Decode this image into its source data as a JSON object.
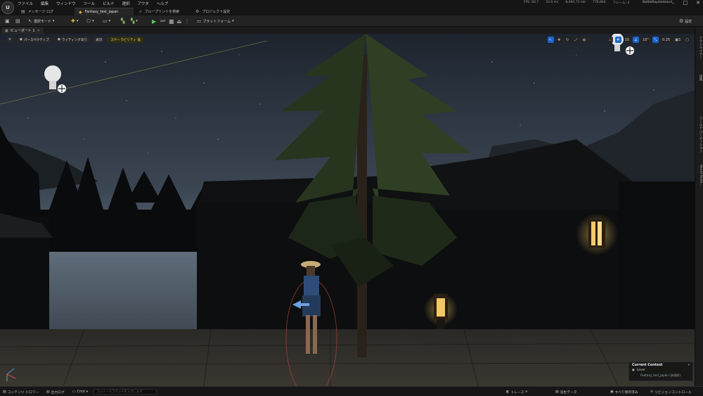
{
  "app": {
    "logo": "U",
    "menu": [
      "ファイル",
      "編集",
      "ウィンドウ",
      "ツール",
      "ビルド",
      "選択",
      "アクタ",
      "ヘルプ"
    ],
    "stats": [
      "FPS: 60.7",
      "33.9 ms",
      "8,494.73 mb",
      "778,864",
      "フレーム: 4"
    ],
    "project_name": "BattleRoyaleIsland",
    "window_controls": [
      "–",
      "□",
      "✕"
    ]
  },
  "tabs": [
    {
      "label": "メッセージ ログ"
    },
    {
      "label": "Fantasy_test_japan"
    },
    {
      "label": "ブループリントを検索"
    },
    {
      "label": "プロジェクト設定"
    }
  ],
  "toolbar": {
    "select_mode": "選択モード",
    "platform": "プラットフォーム",
    "settings": "設定"
  },
  "viewport_tab": {
    "label": "ビューポート 1"
  },
  "viewport_bar": {
    "perspective": "パースペクティブ",
    "lighting": "ライティングあり",
    "show": "表示",
    "scalability": "スケーラビリティ 低",
    "grid_value": "10",
    "angle_value": "10°",
    "scale_value": "0.25",
    "camera_speed": "3"
  },
  "side_dock": [
    "アウトライナー",
    "詳細",
    "ワールド パーティション",
    "World Partit..."
  ],
  "context": {
    "title": "Current Context",
    "level": "Level",
    "map": "Fantasy_test_japan (永続的)"
  },
  "status_bar": {
    "content_drawer": "コンテンツ ドロワー",
    "output_log": "出力ログ",
    "cmd": "Cmd",
    "cmd_placeholder": "コンソールコマンドを入力します",
    "trace": "トレース",
    "derived_data": "派生データ",
    "save_all": "すべて保存済み",
    "revision": "リビジョンコントロール"
  },
  "colors": {
    "sky_top": "#1d242e",
    "sky_horizon": "#5f6d7a",
    "accent_blue": "#1c65c9",
    "lantern": "#f3c867",
    "scalability_text": "#e7d84a"
  }
}
